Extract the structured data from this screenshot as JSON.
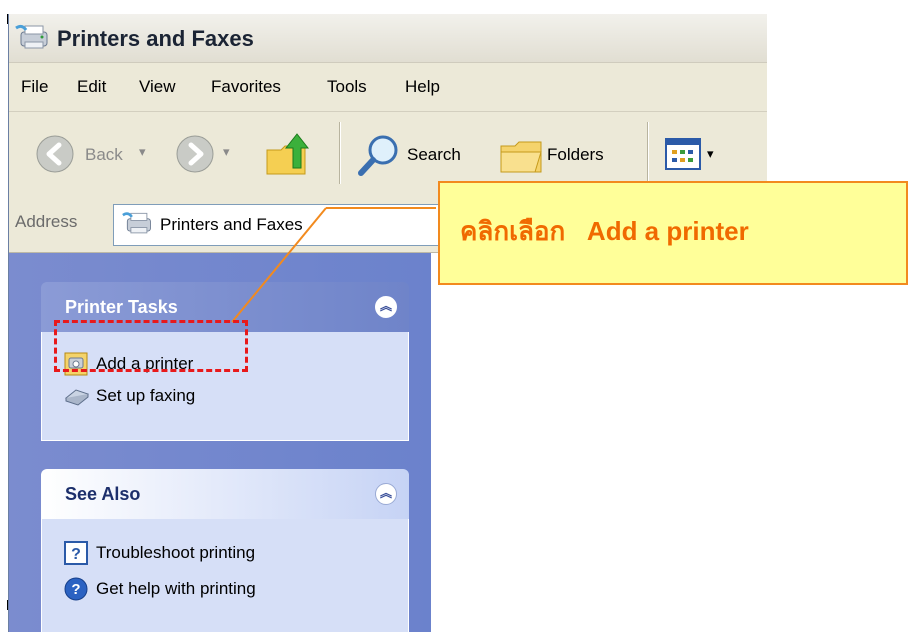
{
  "window": {
    "title": "Printers and Faxes"
  },
  "menu": [
    "File",
    "Edit",
    "View",
    "Favorites",
    "Tools",
    "Help"
  ],
  "toolbar": {
    "back_label": "Back",
    "search_label": "Search",
    "folders_label": "Folders"
  },
  "address": {
    "label": "Address",
    "value": "Printers and Faxes"
  },
  "printer_tasks": {
    "title": "Printer Tasks",
    "items": [
      {
        "label": "Add a printer"
      },
      {
        "label": "Set up faxing"
      }
    ]
  },
  "see_also": {
    "title": "See Also",
    "items": [
      {
        "label": "Troubleshoot printing"
      },
      {
        "label": "Get help with printing"
      }
    ]
  },
  "callout": {
    "text": "คลิกเลือก   Add a printer"
  },
  "colors": {
    "callout_bg": "#ffff99",
    "callout_border": "#f28a1e",
    "callout_text": "#f06a00",
    "highlight": "#e8191b",
    "task_pane": "#7b8ccf"
  },
  "icons": [
    "printers-icon",
    "back-arrow-icon",
    "forward-arrow-icon",
    "up-folder-icon",
    "search-icon",
    "folders-icon",
    "views-icon",
    "chevron-up-icon",
    "add-printer-icon",
    "fax-icon",
    "help-icon"
  ]
}
